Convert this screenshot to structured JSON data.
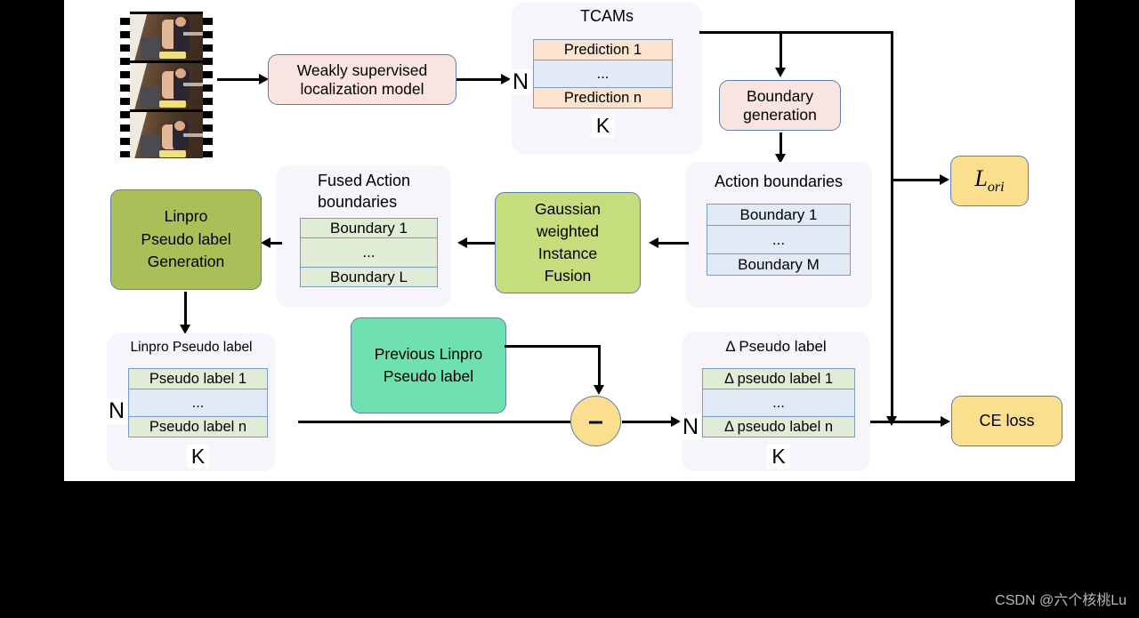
{
  "figure": {
    "background": "#ffffff",
    "watermark": "CSDN @六个核桃Lu"
  },
  "input": {
    "name": "video-filmstrip",
    "frames": 3,
    "description": "video frames"
  },
  "blocks": {
    "wsl_model": "Weakly supervised\nlocalization model",
    "boundary_generation": "Boundary\ngeneration",
    "gaussian_fusion": "Gaussian\nweighted\nInstance\nFusion",
    "linpro_generation": "Linpro\nPseudo label\nGeneration",
    "previous_linpro": "Previous Linpro\nPseudo label",
    "l_ori": "L",
    "l_ori_sub": "ori",
    "ce_loss": "CE loss",
    "minus": "–"
  },
  "groups": {
    "tcams": {
      "title": "TCAMs",
      "rows": [
        "Prediction 1",
        "...",
        "Prediction n"
      ],
      "dim_left": "N",
      "dim_bottom": "K"
    },
    "action_boundaries": {
      "title": "Action boundaries",
      "rows": [
        "Boundary 1",
        "...",
        "Boundary M"
      ]
    },
    "fused_action_boundaries": {
      "title": "Fused Action\nboundaries",
      "title_line1": "Fused Action",
      "title_line2": "boundaries",
      "rows": [
        "Boundary 1",
        "...",
        "Boundary L"
      ]
    },
    "linpro_pseudo_label": {
      "title": "Linpro Pseudo label",
      "rows": [
        "Pseudo label 1",
        "...",
        "Pseudo label n"
      ],
      "dim_left": "N",
      "dim_bottom": "K"
    },
    "delta_pseudo_label": {
      "title": "Δ Pseudo label",
      "rows": [
        "Δ pseudo label 1",
        "...",
        "Δ pseudo  label n"
      ],
      "dim_left": "N",
      "dim_bottom": "K"
    }
  },
  "colors": {
    "panel": "#f7f5fb",
    "pink_box": "#fae4e0",
    "olive_box": "#a9c059",
    "green_box": "#c5dd7c",
    "mint_box": "#6fe0b0",
    "yellow_box": "#fbdf8e",
    "row_orange": "#fce3cd",
    "row_blue": "#e2eaf6",
    "row_green": "#e1ecd6",
    "border_blue": "#5b7fae",
    "arrow": "#000000"
  }
}
